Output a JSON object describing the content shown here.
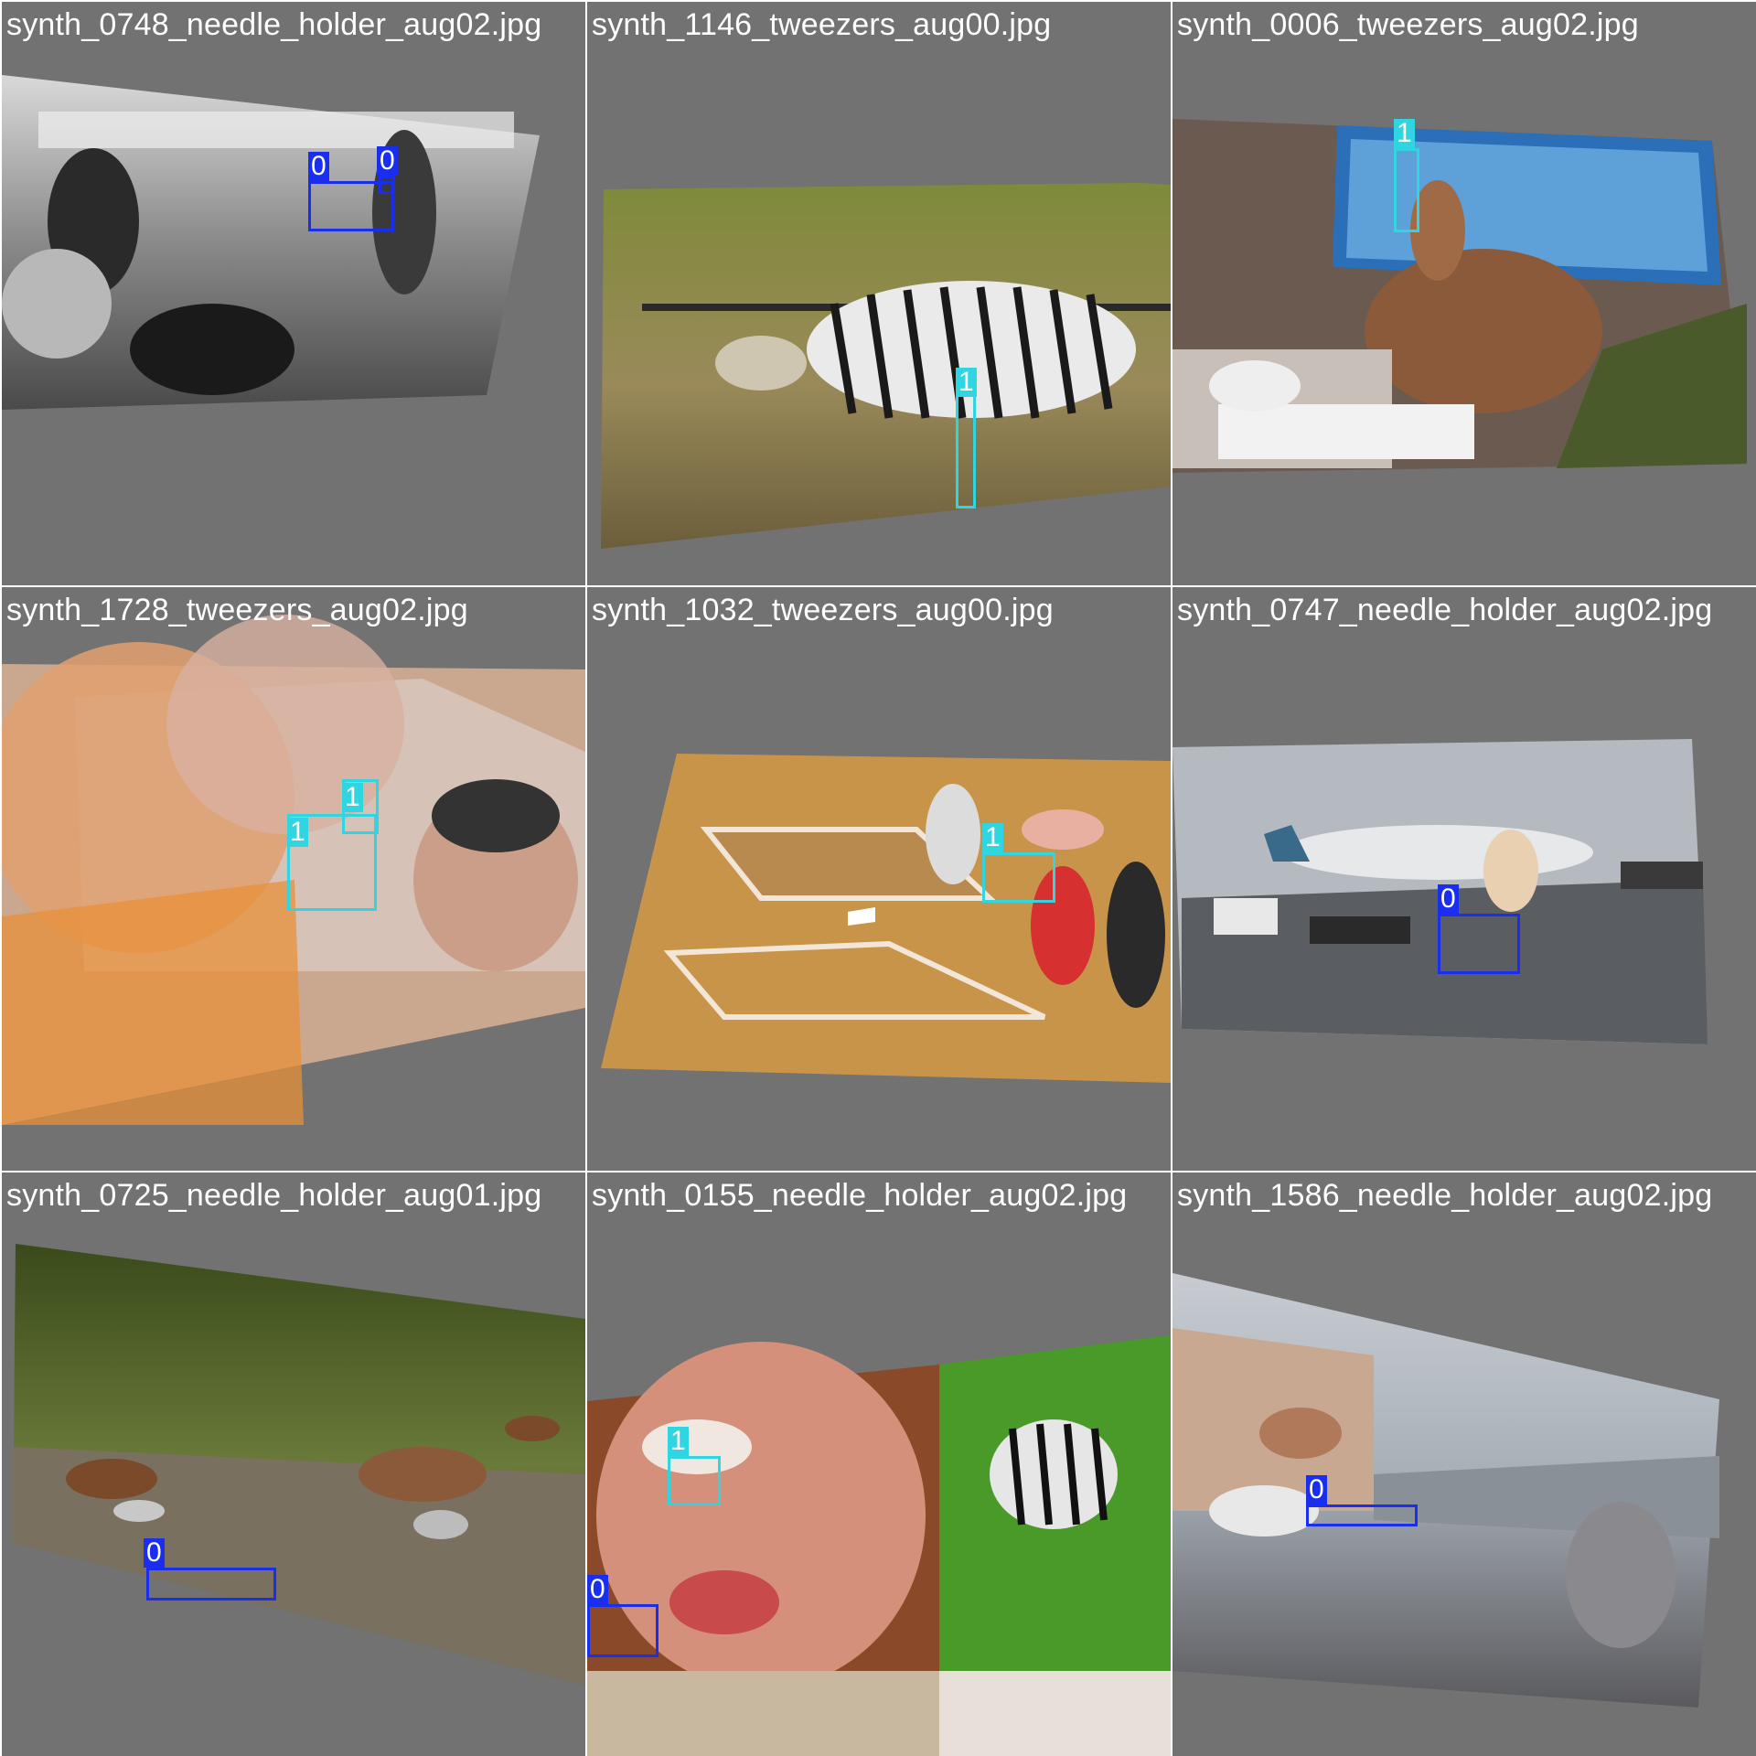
{
  "colors": {
    "class0": "#1a2ef0",
    "class1": "#2fd5e0",
    "background": "#727272"
  },
  "tiles": [
    {
      "title": "synth_0748_needle_holder_aug02.jpg",
      "labels": [
        "0",
        "0"
      ]
    },
    {
      "title": "synth_1146_tweezers_aug00.jpg",
      "labels": [
        "1"
      ]
    },
    {
      "title": "synth_0006_tweezers_aug02.jpg",
      "labels": [
        "1"
      ]
    },
    {
      "title": "synth_1728_tweezers_aug02.jpg",
      "labels": [
        "1",
        "1"
      ]
    },
    {
      "title": "synth_1032_tweezers_aug00.jpg",
      "labels": [
        "1"
      ]
    },
    {
      "title": "synth_0747_needle_holder_aug02.jpg",
      "labels": [
        "0"
      ]
    },
    {
      "title": "synth_0725_needle_holder_aug01.jpg",
      "labels": [
        "0"
      ]
    },
    {
      "title": "synth_0155_needle_holder_aug02.jpg",
      "labels": [
        "1",
        "0"
      ]
    },
    {
      "title": "synth_1586_needle_holder_aug02.jpg",
      "labels": [
        "0"
      ]
    }
  ]
}
